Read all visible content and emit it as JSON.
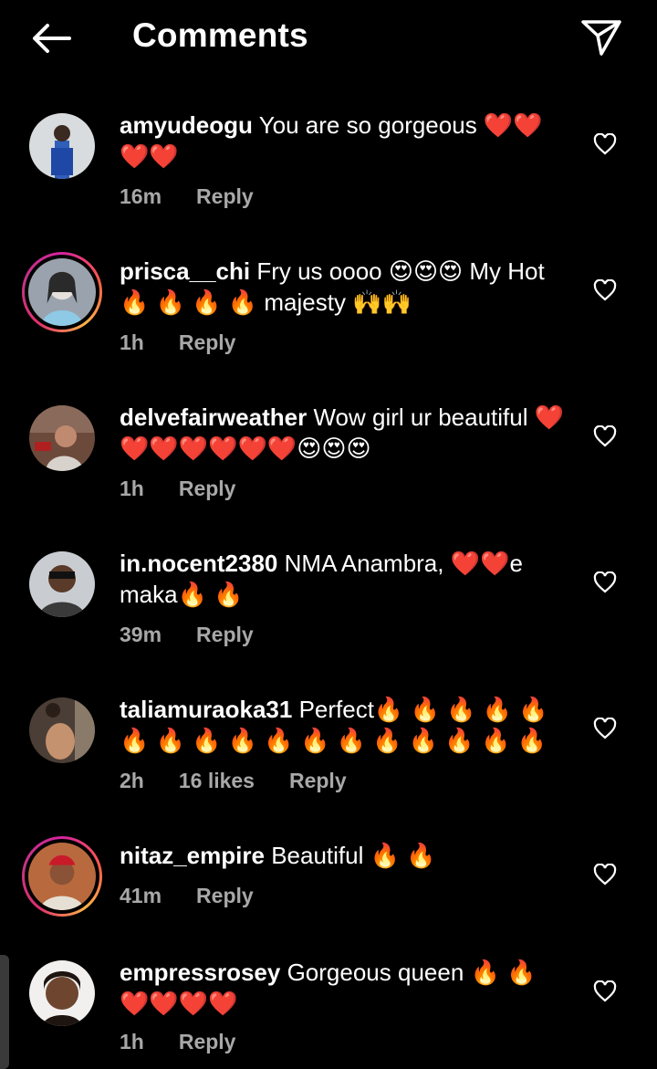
{
  "header": {
    "title": "Comments",
    "back_icon": "arrow-left-icon",
    "share_icon": "paper-plane-icon"
  },
  "comments": [
    {
      "username": "amyudeogu",
      "text": "You are so gorgeous ❤️❤️❤️❤️",
      "time": "16m",
      "likes": "",
      "reply": "Reply",
      "story_ring": false
    },
    {
      "username": "prisca__chi",
      "text": "Fry us oooo 😍😍😍 My Hot 🔥 🔥 🔥 🔥 majesty 🙌🙌",
      "time": "1h",
      "likes": "",
      "reply": "Reply",
      "story_ring": true
    },
    {
      "username": "delvefairweather",
      "text": "Wow girl ur beautiful ❤️❤️❤️❤️❤️❤️❤️😍😍😍",
      "time": "1h",
      "likes": "",
      "reply": "Reply",
      "story_ring": false
    },
    {
      "username": "in.nocent2380",
      "text": "NMA Anambra, ❤️❤️e maka🔥 🔥",
      "time": "39m",
      "likes": "",
      "reply": "Reply",
      "story_ring": false
    },
    {
      "username": "taliamuraoka31",
      "text": "Perfect🔥 🔥 🔥 🔥 🔥 🔥 🔥 🔥 🔥 🔥 🔥 🔥 🔥 🔥 🔥 🔥 🔥",
      "time": "2h",
      "likes": "16 likes",
      "reply": "Reply",
      "story_ring": false
    },
    {
      "username": "nitaz_empire",
      "text": "Beautiful 🔥 🔥",
      "time": "41m",
      "likes": "",
      "reply": "Reply",
      "story_ring": true
    },
    {
      "username": "empressrosey",
      "text": "Gorgeous queen 🔥 🔥 ❤️❤️❤️❤️",
      "time": "1h",
      "likes": "",
      "reply": "Reply",
      "story_ring": false
    }
  ],
  "colors": {
    "background": "#000000",
    "text": "#ffffff",
    "meta": "#a8a8a8"
  }
}
